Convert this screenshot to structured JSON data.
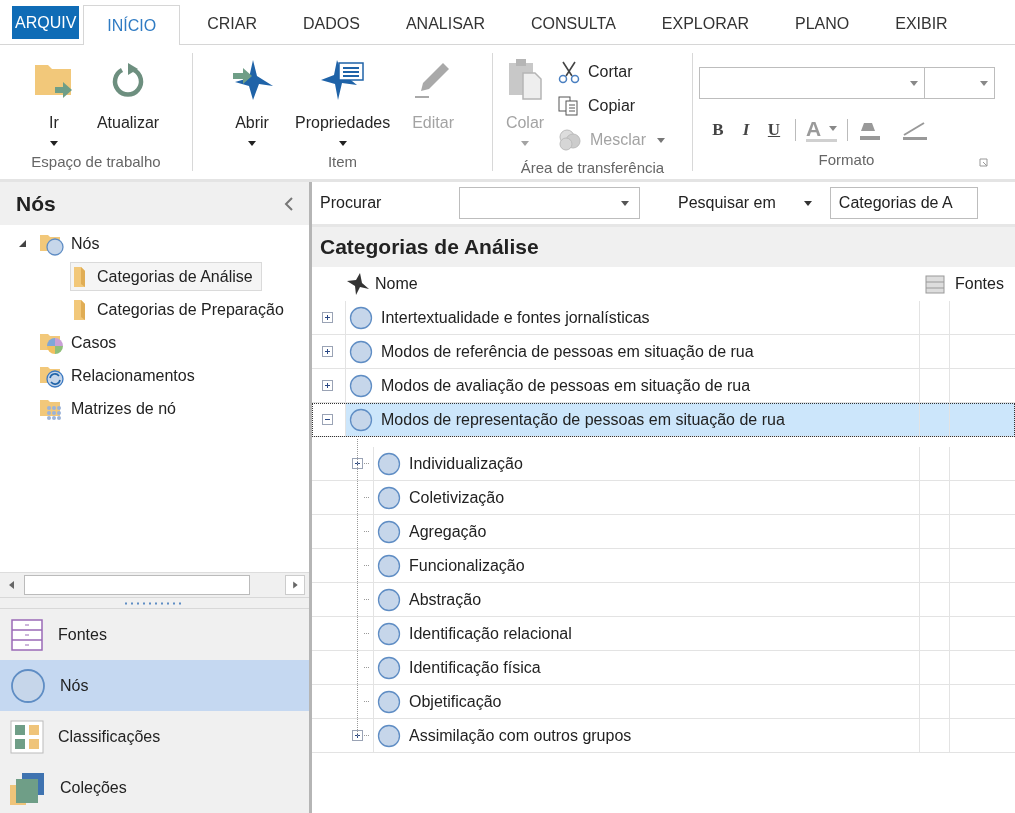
{
  "ribbon": {
    "tabs": [
      {
        "label": "ARQUIV",
        "kind": "file",
        "selected": false
      },
      {
        "label": "INÍCIO",
        "kind": "tab",
        "selected": true
      },
      {
        "label": "CRIAR",
        "kind": "tab",
        "selected": false
      },
      {
        "label": "DADOS",
        "kind": "tab",
        "selected": false
      },
      {
        "label": "ANALISAR",
        "kind": "tab",
        "selected": false
      },
      {
        "label": "CONSULTA",
        "kind": "tab",
        "selected": false
      },
      {
        "label": "EXPLORAR",
        "kind": "tab",
        "selected": false
      },
      {
        "label": "PLANO",
        "kind": "tab",
        "selected": false
      },
      {
        "label": "EXIBIR",
        "kind": "tab",
        "selected": false
      }
    ],
    "groups": [
      {
        "label": "Espaço de trabalho",
        "buttons": [
          {
            "kind": "go",
            "label": "Ir",
            "dropdown": true,
            "disabled": false
          },
          {
            "kind": "refresh",
            "label": "Atualizar",
            "dropdown": false,
            "disabled": false
          }
        ]
      },
      {
        "label": "Item",
        "buttons": [
          {
            "kind": "open",
            "label": "Abrir",
            "dropdown": true,
            "disabled": false
          },
          {
            "kind": "properties",
            "label": "Propriedades",
            "dropdown": true,
            "disabled": false
          },
          {
            "kind": "edit",
            "label": "Editar",
            "dropdown": false,
            "disabled": true
          }
        ]
      },
      {
        "label": "Área de transferência",
        "buttons": [
          {
            "kind": "paste",
            "label": "Colar",
            "dropdown": true,
            "disabled": true
          }
        ],
        "small_buttons": [
          {
            "kind": "cut",
            "label": "Cortar",
            "dropdown": false,
            "disabled": false
          },
          {
            "kind": "copy",
            "label": "Copiar",
            "dropdown": false,
            "disabled": false
          },
          {
            "kind": "merge",
            "label": "Mesclar",
            "dropdown": true,
            "disabled": true
          }
        ]
      },
      {
        "label": "Formato",
        "style_buttons": [
          {
            "kind": "bold",
            "label": "B"
          },
          {
            "kind": "italic",
            "label": "I"
          },
          {
            "kind": "underline",
            "label": "U"
          }
        ],
        "font_color": {
          "label": "A"
        }
      }
    ]
  },
  "navigation": {
    "title": "Nós",
    "tree": [
      {
        "label": "Nós",
        "kind": "nodes",
        "expanded": true,
        "selected": false,
        "children": [
          {
            "label": "Categorias de Análise",
            "kind": "folder",
            "selected": true
          },
          {
            "label": "Categorias de Preparação",
            "kind": "folder",
            "selected": false
          }
        ]
      },
      {
        "label": "Casos",
        "kind": "cases",
        "selected": false
      },
      {
        "label": "Relacionamentos",
        "kind": "relationships",
        "selected": false
      },
      {
        "label": "Matrizes de nó",
        "kind": "matrices",
        "selected": false
      }
    ],
    "buttons": [
      {
        "label": "Fontes",
        "kind": "sources",
        "selected": false
      },
      {
        "label": "Nós",
        "kind": "nodes",
        "selected": true
      },
      {
        "label": "Classificações",
        "kind": "classifications",
        "selected": false
      },
      {
        "label": "Coleções",
        "kind": "collections",
        "selected": false
      }
    ]
  },
  "find_bar": {
    "find_label": "Procurar",
    "search_in_label": "Pesquisar em",
    "search_in_value": "Categorias de A"
  },
  "list": {
    "title": "Categorias de Análise",
    "columns": [
      "Nome",
      "Fontes"
    ],
    "rows": [
      {
        "name": "Intertextualidade e fontes jornalísticas",
        "expandable": true,
        "expanded": false,
        "selected": false
      },
      {
        "name": "Modos de referência de pessoas em situação de rua",
        "expandable": true,
        "expanded": false,
        "selected": false
      },
      {
        "name": "Modos de avaliação de pessoas em situação de rua",
        "expandable": true,
        "expanded": false,
        "selected": false
      },
      {
        "name": "Modos de representação de pessoas em situação de rua",
        "expandable": true,
        "expanded": true,
        "selected": true,
        "children": [
          {
            "name": "Individualização",
            "expandable": true,
            "expanded": false,
            "selected": false
          },
          {
            "name": "Coletivização",
            "expandable": false,
            "selected": false
          },
          {
            "name": "Agregação",
            "expandable": false,
            "selected": false
          },
          {
            "name": "Funcionalização",
            "expandable": false,
            "selected": false
          },
          {
            "name": "Abstração",
            "expandable": false,
            "selected": false
          },
          {
            "name": "Identificação relacional",
            "expandable": false,
            "selected": false
          },
          {
            "name": "Identificação física",
            "expandable": false,
            "selected": false
          },
          {
            "name": "Objetificação",
            "expandable": false,
            "selected": false
          },
          {
            "name": "Assimilação com outros grupos",
            "expandable": true,
            "expanded": false,
            "selected": false
          }
        ]
      }
    ]
  }
}
